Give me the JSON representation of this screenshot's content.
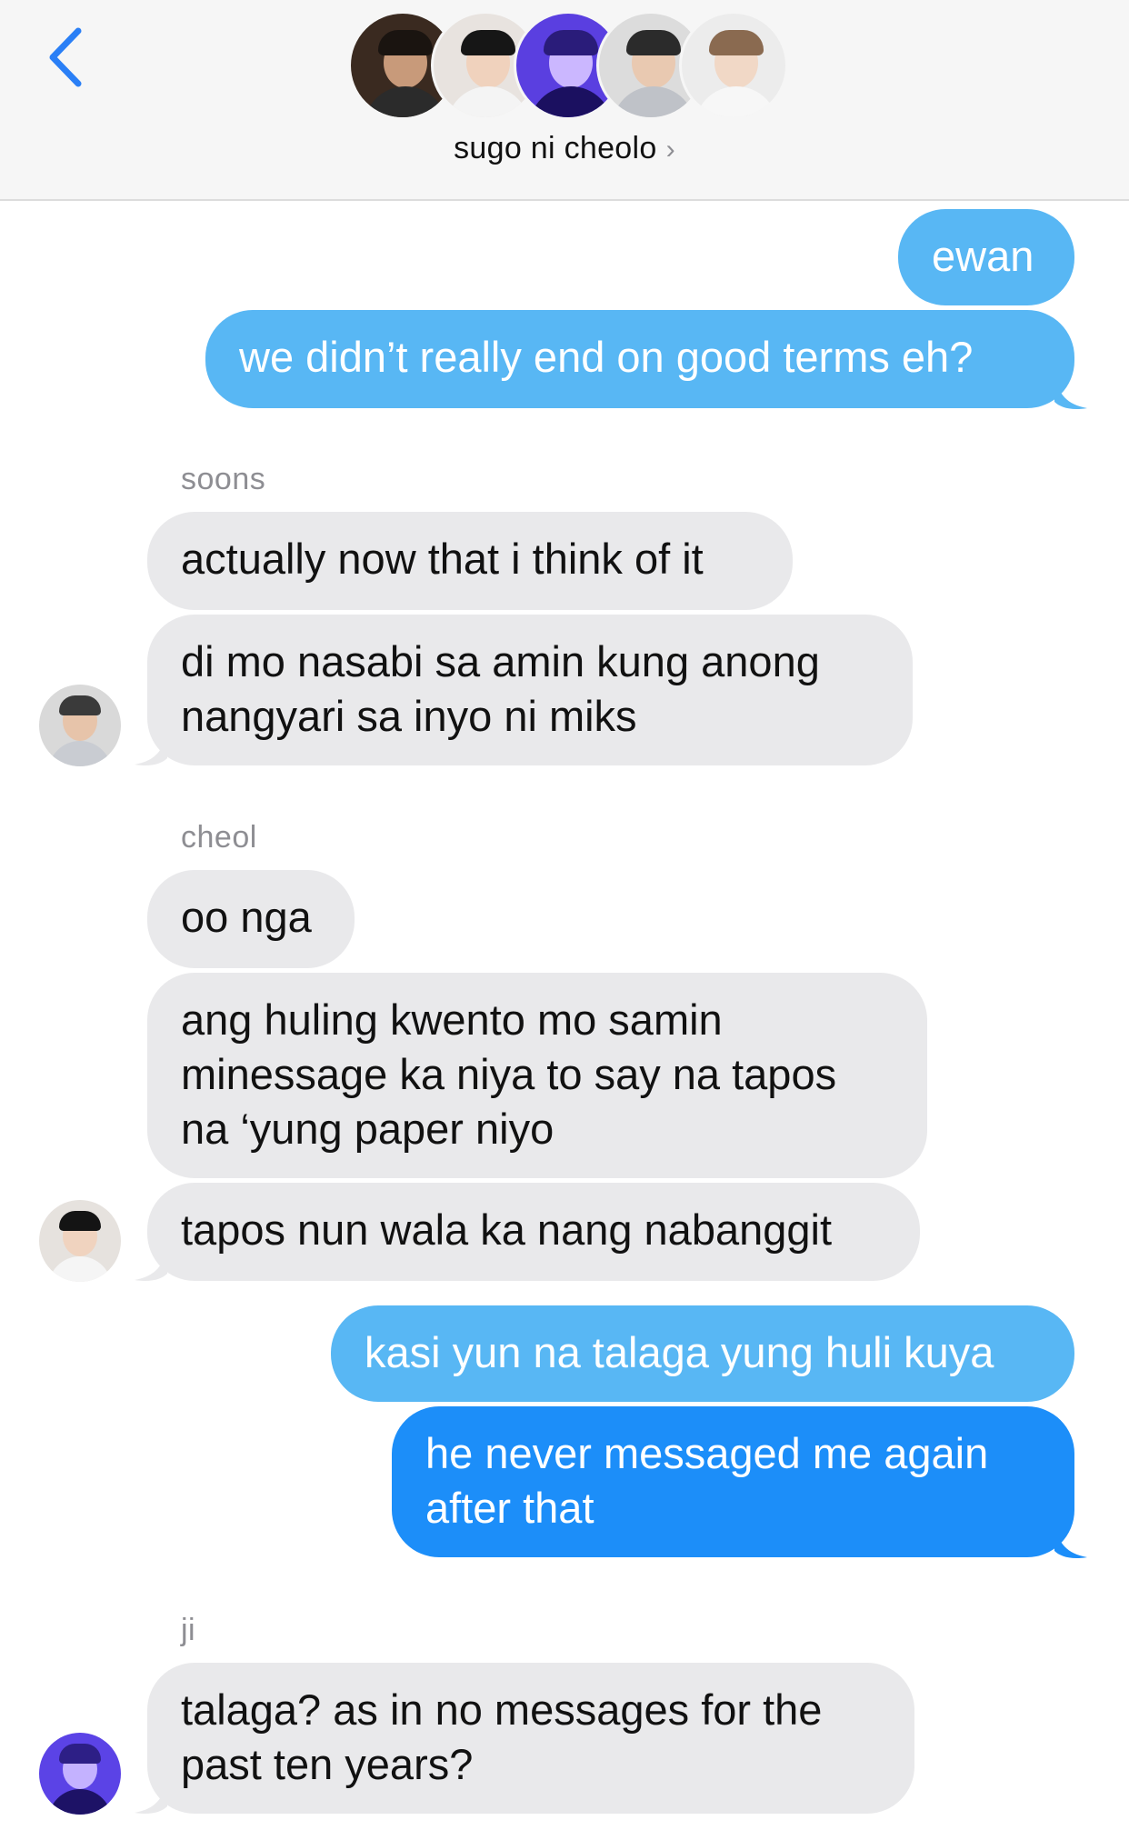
{
  "header": {
    "group_name": "sugo ni cheolo",
    "chevron": "›",
    "back_icon": "chevron-left-icon",
    "accent": "#2a7ff6",
    "avatars": [
      {
        "name": "avatar-1",
        "bg": "#3a2a20",
        "face": "#c89a7a",
        "hair": "#1a1410",
        "body": "#2b2b2b"
      },
      {
        "name": "avatar-2",
        "bg": "#e8e3df",
        "face": "#f0d2bd",
        "hair": "#161616",
        "body": "#f4f4f4"
      },
      {
        "name": "avatar-3",
        "bg": "#5a3fe0",
        "face": "#cbb7ff",
        "hair": "#2a1c7a",
        "body": "#1b1060"
      },
      {
        "name": "avatar-4",
        "bg": "#dcdcdc",
        "face": "#e9c9b1",
        "hair": "#2b2b2b",
        "body": "#bfc2c8"
      },
      {
        "name": "avatar-5",
        "bg": "#ececec",
        "face": "#f1d8c6",
        "hair": "#8a6a50",
        "body": "#f7f7f7"
      }
    ]
  },
  "messages": [
    {
      "id": "m1",
      "direction": "sent",
      "text": "ewan"
    },
    {
      "id": "m2",
      "direction": "sent",
      "text": "we didn’t really end on good terms eh?"
    },
    {
      "id": "s1",
      "sender": "soons"
    },
    {
      "id": "m3",
      "direction": "received",
      "text": "actually now that i think of it"
    },
    {
      "id": "m4",
      "direction": "received",
      "lines": [
        "di mo nasabi sa amin kung anong",
        "nangyari sa inyo ni miks"
      ]
    },
    {
      "id": "s2",
      "sender": "cheol"
    },
    {
      "id": "m5",
      "direction": "received",
      "text": "oo nga"
    },
    {
      "id": "m6",
      "direction": "received",
      "lines": [
        "ang huling kwento mo samin",
        "minessage ka niya to say na tapos",
        "na ‘yung paper niyo"
      ]
    },
    {
      "id": "m7",
      "direction": "received",
      "text": "tapos nun wala ka nang nabanggit"
    },
    {
      "id": "m8",
      "direction": "sent",
      "text": "kasi yun na talaga yung huli kuya"
    },
    {
      "id": "m9",
      "direction": "sent",
      "lines": [
        "he never messaged me again",
        "after that"
      ]
    },
    {
      "id": "s3",
      "sender": "ji"
    },
    {
      "id": "m10",
      "direction": "received",
      "lines": [
        "talaga? as in no messages for the",
        "past ten years?"
      ]
    }
  ],
  "colors": {
    "sent_bubble": "#58b7f4",
    "sent_bubble_latest": "#1c8ef9",
    "received_bubble": "#e9e9eb",
    "header_bg": "#f6f6f6"
  },
  "sender_avatars": {
    "soons": {
      "bg": "#d9d9d9",
      "face": "#e7c4aa",
      "hair": "#3a3a3a",
      "body": "#c9ccd2"
    },
    "cheol": {
      "bg": "#e6e2de",
      "face": "#f0d3bf",
      "hair": "#141414",
      "body": "#f5f5f5"
    },
    "ji": {
      "bg": "#5b43e6",
      "face": "#c4b2ff",
      "hair": "#2d1f86",
      "body": "#1d1266"
    }
  }
}
